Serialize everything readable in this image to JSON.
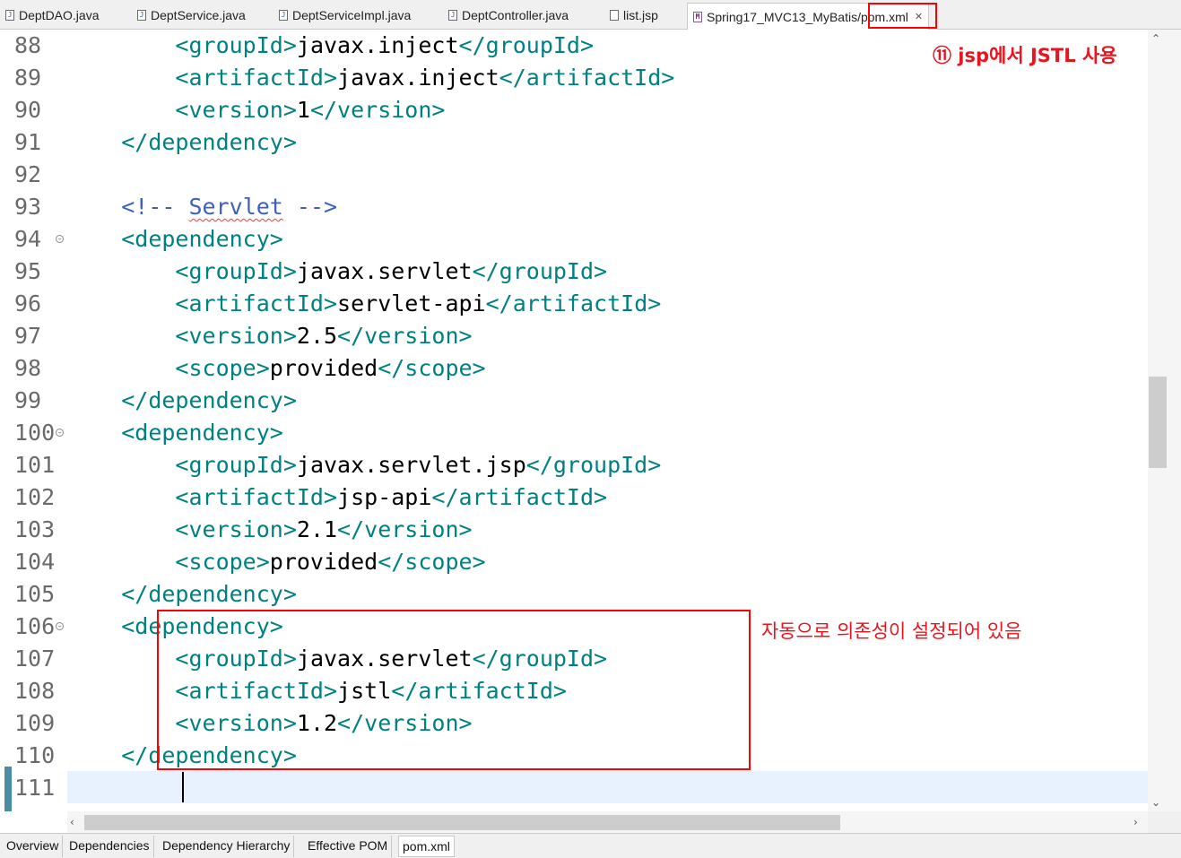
{
  "tabs": [
    {
      "label": "DeptDAO.java",
      "icon": "java-file-icon"
    },
    {
      "label": "DeptService.java",
      "icon": "java-file-icon"
    },
    {
      "label": "DeptServiceImpl.java",
      "icon": "java-file-icon"
    },
    {
      "label": "DeptController.java",
      "icon": "java-file-icon"
    },
    {
      "label": "list.jsp",
      "icon": "jsp-file-icon"
    },
    {
      "label": "Spring17_MVC13_MyBatis/pom.xml",
      "icon": "maven-pom-icon",
      "active": true
    }
  ],
  "editor": {
    "lines": [
      {
        "num": "88",
        "text": "        <groupId>javax.inject</groupId>"
      },
      {
        "num": "89",
        "text": "        <artifactId>javax.inject</artifactId>"
      },
      {
        "num": "90",
        "text": "        <version>1</version>"
      },
      {
        "num": "91",
        "text": "    </dependency>"
      },
      {
        "num": "92",
        "text": ""
      },
      {
        "num": "93",
        "text": "    <!-- Servlet -->"
      },
      {
        "num": "94",
        "text": "    <dependency>",
        "fold": true
      },
      {
        "num": "95",
        "text": "        <groupId>javax.servlet</groupId>"
      },
      {
        "num": "96",
        "text": "        <artifactId>servlet-api</artifactId>"
      },
      {
        "num": "97",
        "text": "        <version>2.5</version>"
      },
      {
        "num": "98",
        "text": "        <scope>provided</scope>"
      },
      {
        "num": "99",
        "text": "    </dependency>"
      },
      {
        "num": "100",
        "text": "    <dependency>",
        "fold": true
      },
      {
        "num": "101",
        "text": "        <groupId>javax.servlet.jsp</groupId>"
      },
      {
        "num": "102",
        "text": "        <artifactId>jsp-api</artifactId>"
      },
      {
        "num": "103",
        "text": "        <version>2.1</version>"
      },
      {
        "num": "104",
        "text": "        <scope>provided</scope>"
      },
      {
        "num": "105",
        "text": "    </dependency>"
      },
      {
        "num": "106",
        "text": "    <dependency>",
        "fold": true
      },
      {
        "num": "107",
        "text": "        <groupId>javax.servlet</groupId>"
      },
      {
        "num": "108",
        "text": "        <artifactId>jstl</artifactId>"
      },
      {
        "num": "109",
        "text": "        <version>1.2</version>"
      },
      {
        "num": "110",
        "text": "    </dependency>"
      },
      {
        "num": "111",
        "text": ""
      }
    ],
    "current_line": "111"
  },
  "annotations": {
    "title": "⑪ jsp에서 JSTL 사용",
    "note": "자동으로 의존성이 설정되어 있음",
    "color": "#e8141e"
  },
  "bottom_tabs": [
    {
      "label": "Overview"
    },
    {
      "label": "Dependencies"
    },
    {
      "label": "Dependency Hierarchy"
    },
    {
      "label": "Effective POM"
    },
    {
      "label": "pom.xml",
      "active": true
    }
  ],
  "colors": {
    "tag": "#008080",
    "comment": "#3f5fbf",
    "current_line": "#e8f2fe",
    "highlight": "#ff0000"
  }
}
